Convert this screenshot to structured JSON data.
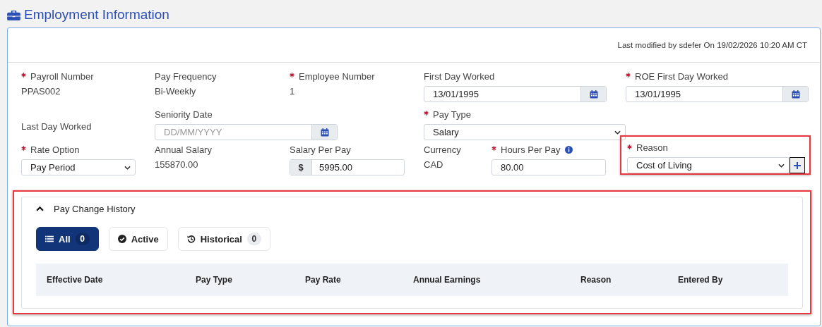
{
  "page": {
    "title": "Employment Information"
  },
  "last_modified": "Last modified by sdefer On 19/02/2026 10:20 AM CT",
  "field_rows": [
    [
      {
        "label": "Payroll Number",
        "required": true,
        "kind": "value",
        "value": "PPAS002"
      },
      {
        "label": "Pay Frequency",
        "required": false,
        "kind": "value",
        "value": "Bi-Weekly"
      },
      {
        "label": "Employee Number",
        "required": true,
        "kind": "value",
        "value": "1"
      },
      {
        "label": "First Day Worked",
        "required": false,
        "kind": "date",
        "value": "13/01/1995"
      },
      {
        "label": "ROE First Day Worked",
        "required": true,
        "kind": "date",
        "value": "13/01/1995"
      }
    ],
    [
      {
        "label": "Last Day Worked",
        "required": false,
        "kind": "label"
      },
      {
        "label": "Seniority Date",
        "required": false,
        "kind": "date",
        "placeholder": "DD/MM/YYYY"
      },
      {
        "label": "Pay Type",
        "required": true,
        "kind": "select",
        "value": "Salary"
      }
    ],
    [
      {
        "label": "Rate Option",
        "required": true,
        "kind": "select",
        "value": "Pay Period"
      },
      {
        "label": "Annual Salary",
        "required": false,
        "kind": "value",
        "value": "155870.00"
      },
      {
        "label": "Salary Per Pay",
        "required": false,
        "kind": "money",
        "currency": "$",
        "value": "5995.00"
      },
      {
        "label": "Currency",
        "required": false,
        "kind": "value",
        "value": "CAD"
      },
      {
        "label": "Hours Per Pay",
        "required": true,
        "kind": "input",
        "value": "80.00",
        "info": true
      },
      {
        "label": "Reason",
        "required": true,
        "kind": "select-add",
        "value": "Cost of Living",
        "highlighted": true
      }
    ]
  ],
  "pay_change_history": {
    "title": "Pay Change History",
    "expanded": true,
    "highlighted": true,
    "filters": [
      {
        "label": "All",
        "count": "0",
        "selected": true,
        "kind": "list"
      },
      {
        "label": "Active",
        "selected": false,
        "kind": "check"
      },
      {
        "label": "Historical",
        "count": "0",
        "selected": false,
        "kind": "history"
      }
    ],
    "columns": [
      "Effective Date",
      "Pay Type",
      "Pay Rate",
      "Annual Earnings",
      "Reason",
      "Entered By"
    ]
  }
}
